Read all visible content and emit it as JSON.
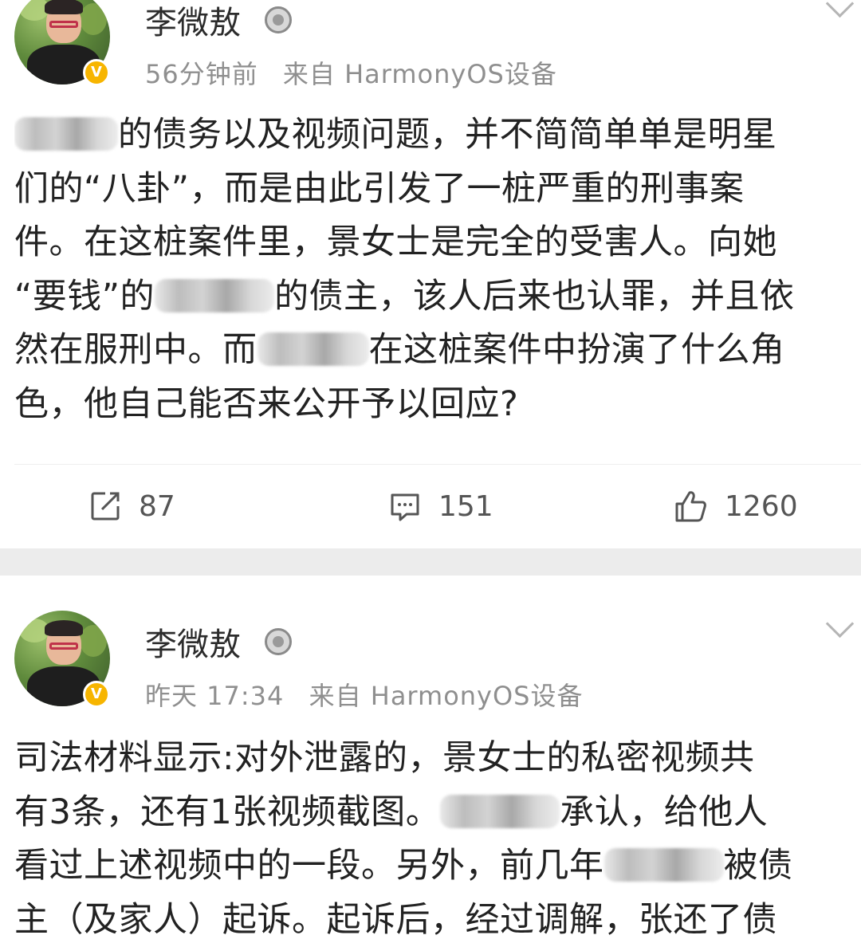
{
  "posts": [
    {
      "username": "李微敖",
      "verified_badge": "V",
      "time": "56分钟前",
      "source": "来自 HarmonyOS设备",
      "content_lines": [
        [
          "",
          "的债务以及视频问题，并不简简单单是明星"
        ],
        [
          "们的“八卦”，而是由此引发了一桩严重的刑事案"
        ],
        [
          "件。在这桩案件里，景女士是完全的受害人。向她"
        ],
        [
          "“要钱”的",
          "",
          "的债主，该人后来也认罪，并且依"
        ],
        [
          "然在服刑中。而",
          "",
          "在这桩案件中扮演了什么角"
        ],
        [
          "色，他自己能否来公开予以回应?"
        ]
      ],
      "actions": {
        "repost": {
          "icon": "repost-icon",
          "count": "87"
        },
        "comment": {
          "icon": "comment-icon",
          "count": "151"
        },
        "like": {
          "icon": "thumbs-up-icon",
          "count": "1260"
        }
      }
    },
    {
      "username": "李微敖",
      "verified_badge": "V",
      "time": "昨天 17:34",
      "source": "来自 HarmonyOS设备",
      "content_lines": [
        [
          "司法材料显示:对外泄露的，景女士的私密视频共"
        ],
        [
          "有3条，还有1张视频截图。",
          "",
          "承认，给他人"
        ],
        [
          "看过上述视频中的一段。另外，前几年",
          "",
          "被债"
        ],
        [
          "主（及家人）起诉。起诉后，经过调解，张还了债"
        ]
      ]
    }
  ],
  "colors": {
    "text": "#222222",
    "meta": "#8f8f8f",
    "badge": "#f7b500",
    "separator": "#ececec"
  }
}
